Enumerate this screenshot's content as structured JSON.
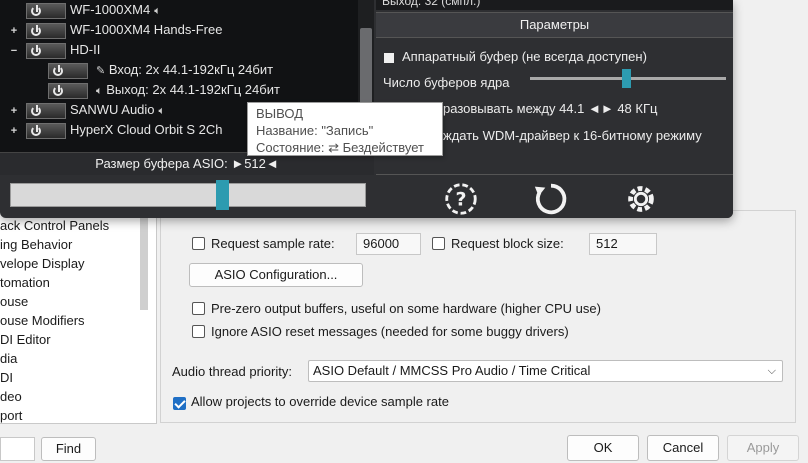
{
  "tree": {
    "items": [
      "ack Control Panels",
      "ing Behavior",
      "velope Display",
      "tomation",
      "ouse",
      "ouse Modifiers",
      "DI Editor",
      "dia",
      "DI",
      "deo",
      "port"
    ]
  },
  "find": {
    "input_value": "",
    "button_label": "Find"
  },
  "settings": {
    "request_sample_rate_label": "Request sample rate:",
    "sample_rate_value": "96000",
    "request_block_size_label": "Request block size:",
    "block_size_value": "512",
    "asio_config_label": "ASIO Configuration...",
    "prezero_label": "Pre-zero output buffers, useful on some hardware (higher CPU use)",
    "ignore_reset_label": "Ignore ASIO reset messages (needed for some buggy drivers)",
    "thread_priority_label": "Audio thread priority:",
    "thread_priority_value": "ASIO Default / MMCSS Pro Audio / Time Critical",
    "allow_override_label": "Allow projects to override device sample rate",
    "allow_override_checked": true
  },
  "dialog_buttons": {
    "ok": "OK",
    "cancel": "Cancel",
    "apply": "Apply"
  },
  "asio": {
    "devices": [
      {
        "expander": "",
        "name": "WF-1000XM4",
        "icon": "speaker-icon"
      },
      {
        "expander": "+",
        "name": "WF-1000XM4 Hands-Free",
        "icon": ""
      },
      {
        "expander": "−",
        "name": "HD-II",
        "icon": ""
      },
      {
        "expander": "",
        "name": "Вход: 2x 44.1-192кГц 24бит",
        "icon": "microphone-icon"
      },
      {
        "expander": "",
        "name": "Выход: 2x 44.1-192кГц 24бит",
        "icon": "speaker-icon"
      },
      {
        "expander": "+",
        "name": "SANWU Audio",
        "icon": "speaker-icon"
      },
      {
        "expander": "+",
        "name": "HyperX Cloud Orbit S 2Ch",
        "icon": ""
      }
    ],
    "buffer_caption": "Размер буфера ASIO: ►512◄",
    "buffer_slider_fraction": 0.6,
    "top_partial_text": "Выход: 32 (смпл.)",
    "params_header": "Параметры",
    "hw_buffer_label": "Аппаратный буфер (не всегда доступен)",
    "buffer_count_label": "Число буферов ядра",
    "resample_text": "разовывать между 44.1 ◄► 48 КГц",
    "wdm_text": "ждать WDM-драйвер к 16-битному режиму"
  },
  "tooltip": {
    "title": "ВЫВОД",
    "name_line": "Название: \"Запись\"",
    "state_line": "Состояние: ⇄ Бездействует"
  }
}
